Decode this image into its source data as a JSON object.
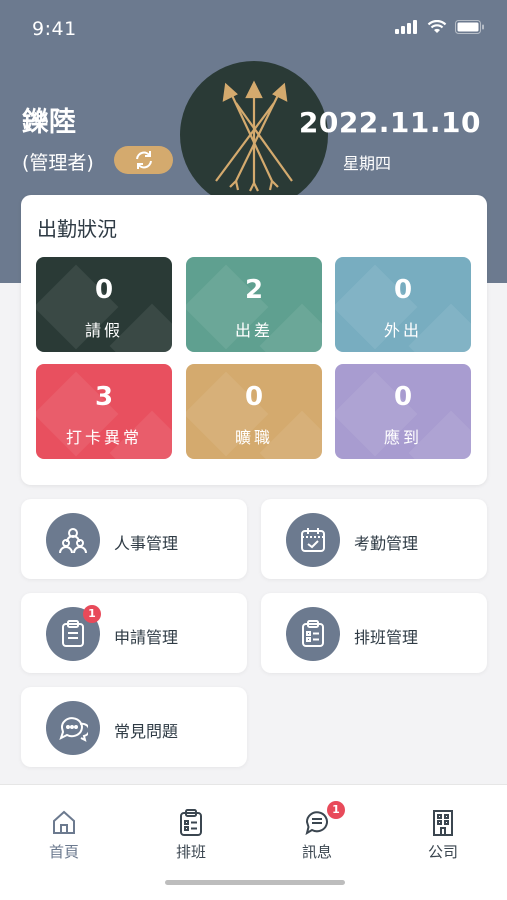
{
  "status_bar": {
    "time": "9:41"
  },
  "header": {
    "user_name": "鑠陸",
    "user_role": "(管理者)",
    "date": "2022.11.10",
    "weekday": "星期四"
  },
  "attendance": {
    "title": "出勤狀況",
    "tiles": [
      {
        "count": "0",
        "label": "請假",
        "color": "#2a3a36"
      },
      {
        "count": "2",
        "label": "出差",
        "color": "#5fa090"
      },
      {
        "count": "0",
        "label": "外出",
        "color": "#78adc0"
      },
      {
        "count": "3",
        "label": "打卡異常",
        "color": "#e8505f"
      },
      {
        "count": "0",
        "label": "曠職",
        "color": "#d4aa6e"
      },
      {
        "count": "0",
        "label": "應到",
        "color": "#a89cd0"
      }
    ]
  },
  "menu": {
    "items": [
      {
        "label": "人事管理",
        "icon": "people-icon"
      },
      {
        "label": "考勤管理",
        "icon": "calendar-check-icon"
      },
      {
        "label": "申請管理",
        "icon": "clipboard-icon",
        "badge": "1"
      },
      {
        "label": "排班管理",
        "icon": "schedule-list-icon"
      },
      {
        "label": "常見問題",
        "icon": "chat-bubbles-icon"
      }
    ]
  },
  "bottom_nav": {
    "items": [
      {
        "label": "首頁",
        "icon": "home-icon"
      },
      {
        "label": "排班",
        "icon": "clipboard-icon"
      },
      {
        "label": "訊息",
        "icon": "message-icon",
        "badge": "1"
      },
      {
        "label": "公司",
        "icon": "building-icon"
      }
    ]
  },
  "colors": {
    "header": "#6c7a8f",
    "accent_gold": "#d4aa6e",
    "badge_red": "#e84a5a"
  }
}
